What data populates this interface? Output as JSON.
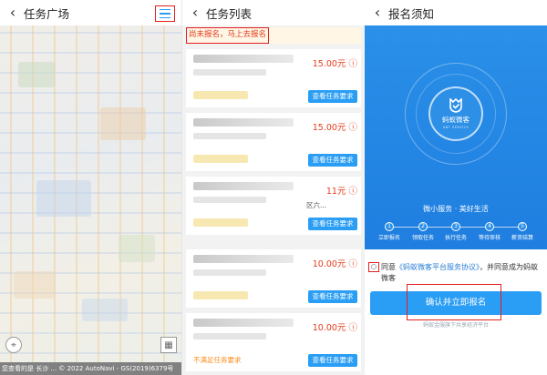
{
  "colors": {
    "accent": "#2a9df4",
    "price": "#e23c1c",
    "highlight": "#e02020",
    "warn": "#ff8c1a"
  },
  "square": {
    "title": "任务广场",
    "back_icon": "chevron-left-icon",
    "menu_icon": "menu-icon",
    "map_footer": "您查看的是 长沙 ... © 2022 AutoNavi - GS(2019)6379号"
  },
  "list": {
    "title": "任务列表",
    "notice": "尚未报名，马上去报名",
    "cards": [
      {
        "price": "15.00元",
        "button": "查看任务要求",
        "extra": "",
        "warn": ""
      },
      {
        "price": "15.00元",
        "button": "查看任务要求",
        "extra": "",
        "warn": ""
      },
      {
        "price": "11元",
        "button": "查看任务要求",
        "extra": "区六...",
        "warn": ""
      },
      {
        "price": "10.00元",
        "button": "查看任务要求",
        "extra": "",
        "warn": ""
      },
      {
        "price": "10.00元",
        "button": "查看任务要求",
        "extra": "",
        "warn": "不满足任务要求"
      }
    ]
  },
  "register": {
    "title": "报名须知",
    "logo_name": "蚂蚁微客",
    "logo_sub": "ANT SERVICE",
    "slogan": "微小服务 · 美好生活",
    "steps": [
      {
        "num": "1",
        "label": "立即报名"
      },
      {
        "num": "2",
        "label": "领取任务"
      },
      {
        "num": "3",
        "label": "执行任务"
      },
      {
        "num": "4",
        "label": "等待审核"
      },
      {
        "num": "5",
        "label": "薪资结算"
      }
    ],
    "agree_prefix": "同意",
    "agree_link": "《蚂蚁微客平台服务协议》",
    "agree_suffix": "，并同意成为蚂蚁微客",
    "confirm": "确认并立即报名",
    "footer": "蚂蚁金服旗下共享经济平台"
  }
}
